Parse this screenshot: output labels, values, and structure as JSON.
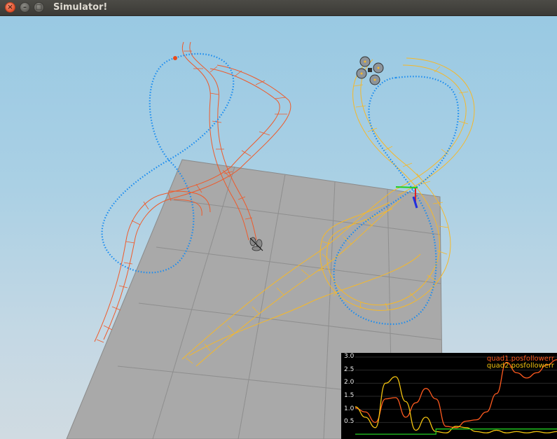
{
  "window": {
    "title": "Simulator!",
    "close_glyph": "×",
    "min_glyph": "–",
    "max_glyph": "□"
  },
  "colors": {
    "quad1_trail": "#ef5a2a",
    "quad2_trail": "#f5b82a",
    "target_path": "#1a8cf0",
    "ground": "#a8a8a8",
    "plot_background": "#000000"
  },
  "plot": {
    "y_ticks": [
      "3.0",
      "2.5",
      "2.0",
      "1.5",
      "1.0",
      "0.5"
    ],
    "legend": [
      {
        "label": "quad1.posfollowerr",
        "color": "#ff5a1f"
      },
      {
        "label": "quad2.posfollowerr",
        "color": "#f2c20f"
      }
    ]
  },
  "chart_data": {
    "type": "line",
    "ylim": [
      0,
      3.0
    ],
    "series": [
      {
        "name": "quad1.posfollowerr",
        "x": [
          0,
          2,
          4,
          6,
          8,
          10,
          12,
          14,
          16,
          18,
          20,
          22,
          24,
          26,
          28,
          30,
          32,
          34,
          36,
          38,
          40
        ],
        "values": [
          1.05,
          0.9,
          0.5,
          1.4,
          1.45,
          0.7,
          1.25,
          1.8,
          1.4,
          0.35,
          0.3,
          0.55,
          0.6,
          0.9,
          1.6,
          2.8,
          2.4,
          2.2,
          2.4,
          2.7,
          2.9
        ]
      },
      {
        "name": "quad2.posfollowerr",
        "x": [
          0,
          2,
          4,
          6,
          8,
          10,
          12,
          14,
          16,
          18,
          20,
          22,
          24,
          26,
          28,
          30,
          32,
          34,
          36,
          38,
          40
        ],
        "values": [
          1.1,
          0.7,
          0.3,
          2.0,
          2.25,
          1.3,
          0.2,
          0.7,
          0.15,
          0.1,
          0.35,
          0.3,
          0.15,
          0.1,
          0.2,
          0.1,
          0.15,
          0.1,
          0.15,
          0.1,
          0.15
        ]
      },
      {
        "name": "",
        "x": [
          0,
          2,
          4,
          6,
          8,
          10,
          12,
          14,
          16,
          18,
          20,
          22,
          24,
          26,
          28,
          30,
          32,
          34,
          36,
          38,
          40
        ],
        "values": [
          0.05,
          0.05,
          0.05,
          0.05,
          0.05,
          0.05,
          0.05,
          0.05,
          0.25,
          0.25,
          0.25,
          0.25,
          0.25,
          0.25,
          0.25,
          0.25,
          0.25,
          0.25,
          0.25,
          0.25,
          0.25
        ]
      }
    ]
  }
}
